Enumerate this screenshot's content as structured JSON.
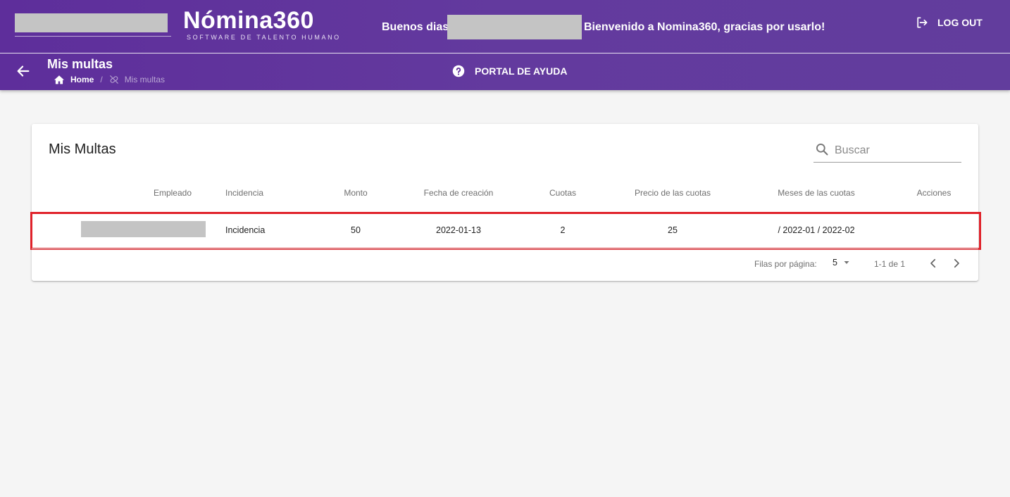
{
  "header": {
    "logo_word": "Nómina360",
    "logo_tagline": "SOFTWARE DE TALENTO HUMANO",
    "greeting_prefix": "Buenos dias",
    "greeting_suffix": "Bienvenido a Nomina360, gracias por usarlo!",
    "logout_label": "LOG OUT"
  },
  "subheader": {
    "page_title": "Mis multas",
    "breadcrumb_home": "Home",
    "breadcrumb_separator": "/",
    "breadcrumb_current": "Mis multas",
    "help_label": "PORTAL DE AYUDA"
  },
  "card": {
    "title": "Mis Multas",
    "search_placeholder": "Buscar"
  },
  "table": {
    "columns": [
      "Empleado",
      "Incidencia",
      "Monto",
      "Fecha de creación",
      "Cuotas",
      "Precio de las cuotas",
      "Meses de las cuotas",
      "Acciones"
    ],
    "rows": [
      {
        "incidencia": "Incidencia",
        "monto": "50",
        "fecha": "2022-01-13",
        "cuotas": "2",
        "precio": "25",
        "meses": "/ 2022-01 / 2022-02"
      }
    ]
  },
  "pagination": {
    "rows_per_page_label": "Filas por página:",
    "rows_per_page_value": "5",
    "range_text": "1-1 de 1"
  },
  "colors": {
    "brand_purple": "#5e2e9b",
    "highlight_red": "#e0222a",
    "redaction_gray": "#c4c4c4"
  },
  "icons": [
    "logout-icon",
    "back-arrow-icon",
    "home-icon",
    "link-off-icon",
    "help-circle-icon",
    "search-icon",
    "dropdown-arrow-icon",
    "chevron-left-icon",
    "chevron-right-icon"
  ]
}
